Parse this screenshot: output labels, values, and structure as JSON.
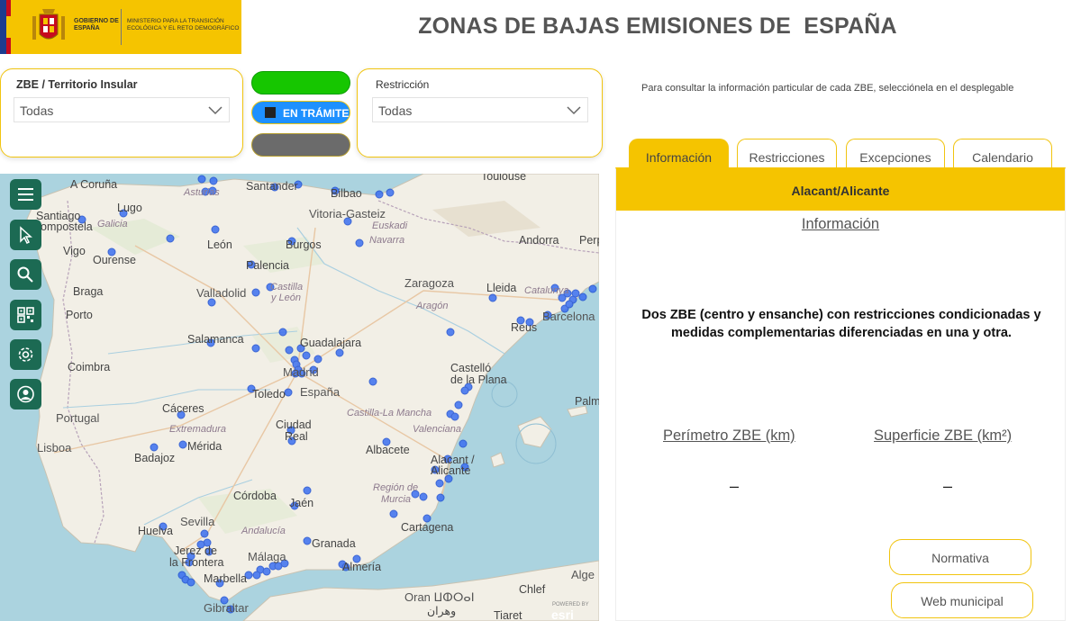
{
  "header": {
    "logo_gobierno": "GOBIERNO DE ESPAÑA",
    "logo_ministerio": "MINISTERIO PARA LA TRANSICIÓN ECOLÓGICA Y EL RETO DEMOGRÁFICO",
    "title": "ZONAS DE BAJAS EMISIONES DE  ESPAÑA"
  },
  "filters": {
    "zbe": {
      "label": "ZBE / Territorio Insular",
      "value": "Todas"
    },
    "estado": {
      "tramite_label": "EN TRÁMITE",
      "colors": {
        "active": "#16c600",
        "tramite": "#1e90ff",
        "inactive": "#6b6b6b"
      }
    },
    "restriccion": {
      "label": "Restricción",
      "value": "Todas"
    }
  },
  "hint": "Para consultar la información particular de cada ZBE, selecciónela en el desplegable",
  "map": {
    "tools": [
      "menu-icon",
      "pointer-icon",
      "search-icon",
      "qr-icon",
      "gear-icon",
      "user-icon"
    ],
    "marker_color": "#3b6ff0",
    "labels": {
      "toulouse": "Toulouse",
      "acoruna": "A Coruña",
      "santander": "Santander",
      "bilbao": "Bilbao",
      "asturias": "Asturias",
      "santiago": "Santiago",
      "compostela": "Compostela",
      "lugo": "Lugo",
      "galicia": "Galicia",
      "vitoria": "Vitoria-Gasteiz",
      "euskadi": "Euskadi",
      "navarra": "Navarra",
      "andorra": "Andorra",
      "perp": "Perp",
      "vigo": "Vigo",
      "ourense": "Ourense",
      "leon": "León",
      "burgos": "Burgos",
      "palencia": "Palencia",
      "castilla": "Castilla",
      "yleon": "y León",
      "braga": "Braga",
      "valladolid": "Valladolid",
      "zaragoza": "Zaragoza",
      "lleida": "Lleida",
      "catalunya": "Catalunya",
      "porto": "Porto",
      "aragon": "Aragón",
      "barcelona": "Barcelona",
      "salamanca": "Salamanca",
      "guadalajara": "Guadalajara",
      "reus": "Reus",
      "coimbra": "Coimbra",
      "madrid": "Madrid",
      "castello": "Castelló",
      "delaplana": "de la Plana",
      "toledo": "Toledo",
      "espana": "España",
      "palma": "Palm",
      "caceres": "Cáceres",
      "portugal": "Portugal",
      "castillalamancha": "Castilla-La Mancha",
      "ciudad": "Ciudad",
      "real": "Real",
      "extremadura": "Extremadura",
      "valenciana": "Valenciana",
      "lisboa": "Lisboa",
      "merida": "Mérida",
      "albacete": "Albacete",
      "badajoz": "Badajoz",
      "alacant": "Alacant /",
      "alicante": "Alicante",
      "regiondemurcia": "Región de",
      "murcia": "Murcia",
      "cordoba": "Córdoba",
      "jaen": "Jaén",
      "sevilla": "Sevilla",
      "huelva": "Huelva",
      "andalucia": "Andalucía",
      "cartagena": "Cartagena",
      "granada": "Granada",
      "jerez": "Jerez de",
      "lafrontera": "la Frontera",
      "malaga": "Málaga",
      "almeria": "Almería",
      "marbella": "Marbella",
      "alge": "Alge",
      "oran": "Oran ⵡⵀⵔⴰⵏ",
      "oranar": "وهران",
      "gibraltar": "Gibraltar",
      "chlef": "Chlef",
      "tiaret": "Tiaret",
      "esri": "esri",
      "esri_powered": "POWERED BY"
    }
  },
  "tabs": [
    {
      "label": "Información",
      "active": true
    },
    {
      "label": "Restricciones",
      "active": false
    },
    {
      "label": "Excepciones",
      "active": false
    },
    {
      "label": "Calendario",
      "active": false
    }
  ],
  "panel": {
    "zone_name": "Alacant/Alicante",
    "section_title": "Información",
    "description": "Dos ZBE (centro y ensanche) con restricciones condicionadas y medidas complementarias diferenciadas en una y otra.",
    "perimetro_label": "Perímetro ZBE (km)",
    "perimetro_value": "–",
    "superficie_label": "Superficie ZBE (km²)",
    "superficie_value": "–",
    "normativa_button": "Normativa",
    "web_button": "Web municipal"
  }
}
